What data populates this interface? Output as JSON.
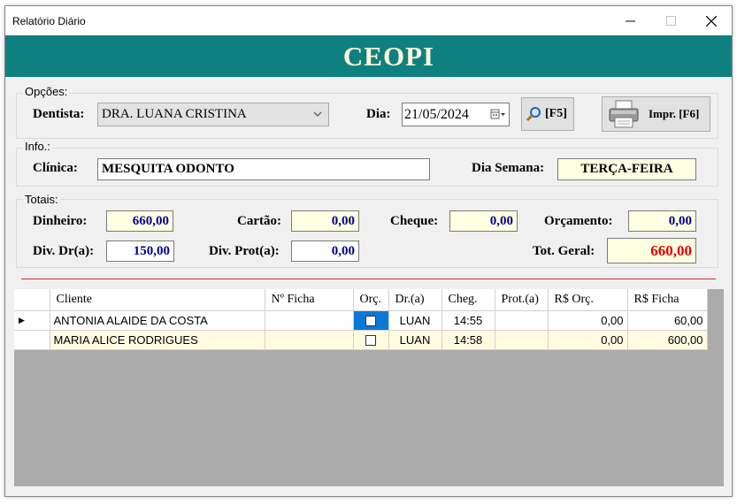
{
  "window": {
    "title": "Relatório Diário",
    "controls": {
      "minimize": "—",
      "maximize": "☐",
      "close": "✕"
    }
  },
  "banner": {
    "text": "CEOPI",
    "bg": "#0f8080"
  },
  "opcoes": {
    "group_label": "Opções:",
    "dentista_label": "Dentista:",
    "dentista_value": "DRA. LUANA CRISTINA",
    "dia_label": "Dia:",
    "dia_value": "21/05/2024",
    "search_button": "[F5]",
    "print_button": "Impr. [F6]"
  },
  "info": {
    "group_label": "Info.:",
    "clinica_label": "Clínica:",
    "clinica_value": "MESQUITA ODONTO",
    "dia_semana_label": "Dia Semana:",
    "dia_semana_value": "TERÇA-FEIRA"
  },
  "totais": {
    "group_label": "Totais:",
    "dinheiro_label": "Dinheiro:",
    "dinheiro_value": "660,00",
    "cartao_label": "Cartão:",
    "cartao_value": "0,00",
    "cheque_label": "Cheque:",
    "cheque_value": "0,00",
    "orcamento_label": "Orçamento:",
    "orcamento_value": "0,00",
    "div_dr_label": "Div. Dr(a):",
    "div_dr_value": "150,00",
    "div_prot_label": "Div. Prot(a):",
    "div_prot_value": "0,00",
    "tot_geral_label": "Tot. Geral:",
    "tot_geral_value": "660,00"
  },
  "table": {
    "columns": [
      "Cliente",
      "Nº Ficha",
      "Orç.",
      "Dr.(a)",
      "Cheg.",
      "Prot.(a)",
      "R$ Orç.",
      "R$ Ficha"
    ],
    "rows": [
      {
        "cliente": "ANTONIA ALAIDE DA COSTA",
        "ficha": "",
        "orc_checked": false,
        "dr": "LUAN",
        "cheg": "14:55",
        "prot": "",
        "rs_orc": "0,00",
        "rs_ficha": "60,00"
      },
      {
        "cliente": "MARIA  ALICE  RODRIGUES",
        "ficha": "",
        "orc_checked": false,
        "dr": "LUAN",
        "cheg": "14:58",
        "prot": "",
        "rs_orc": "0,00",
        "rs_ficha": "600,00"
      }
    ]
  },
  "colors": {
    "accent": "#0f8080",
    "selection": "#0a78d7",
    "total_red": "#e00000",
    "value_blue": "#00008b",
    "field_yellow": "#ffffe1"
  }
}
